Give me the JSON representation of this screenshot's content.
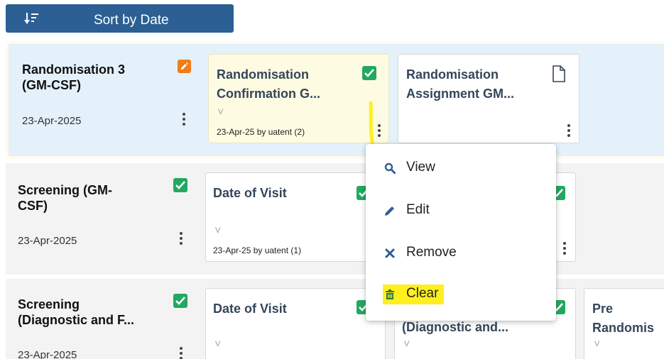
{
  "toolbar": {
    "sort_label": "Sort by Date",
    "sort_icon": "sort-descending-icon"
  },
  "visits": [
    {
      "title": "Randomisation 3 (GM-CSF)",
      "title_lines": [
        "Randomisation 3",
        "(GM-CSF)"
      ],
      "date": "23-Apr-2025",
      "status_icon": "edit-icon",
      "forms": [
        {
          "title_lines": [
            "Randomisation",
            "Confirmation G..."
          ],
          "v": "V",
          "meta": "23-Apr-25 by uatent (2)",
          "status_icon": "check-icon"
        },
        {
          "title_lines": [
            "Randomisation",
            "Assignment GM..."
          ],
          "status_icon": "document-icon"
        }
      ]
    },
    {
      "title_lines": [
        "Screening (GM-",
        "CSF)"
      ],
      "date": "23-Apr-2025",
      "status_icon": "check-icon",
      "forms": [
        {
          "title_lines": [
            "Date of Visit"
          ],
          "v": "V",
          "meta": "23-Apr-25 by uatent (1)",
          "status_icon": "check-icon"
        }
      ]
    },
    {
      "title_lines": [
        "Screening",
        "(Diagnostic and F..."
      ],
      "date": "23-Apr-2025",
      "status_icon": "check-icon",
      "forms": [
        {
          "title_lines": [
            "Date of Visit"
          ],
          "v": "V",
          "status_icon": "check-icon"
        },
        {
          "title_lines": [
            "(Diagnostic and..."
          ],
          "v": "V",
          "status_icon": "check-icon"
        },
        {
          "title_lines": [
            "Pre",
            "Randomis"
          ],
          "v": "V"
        }
      ]
    }
  ],
  "context_menu": {
    "items": [
      {
        "label": "View",
        "icon": "search-icon"
      },
      {
        "label": "Edit",
        "icon": "pencil-icon"
      },
      {
        "label": "Remove",
        "icon": "close-icon"
      },
      {
        "label": "Clear",
        "icon": "trash-icon",
        "highlighted": true
      }
    ]
  },
  "colors": {
    "sort_button": "#2c5f94",
    "selected_row": "#e4f1fb",
    "row": "#f3f3f3",
    "check": "#22a861",
    "edit": "#f07d1a",
    "highlight": "#ffef1f",
    "card_title": "#35465a"
  }
}
